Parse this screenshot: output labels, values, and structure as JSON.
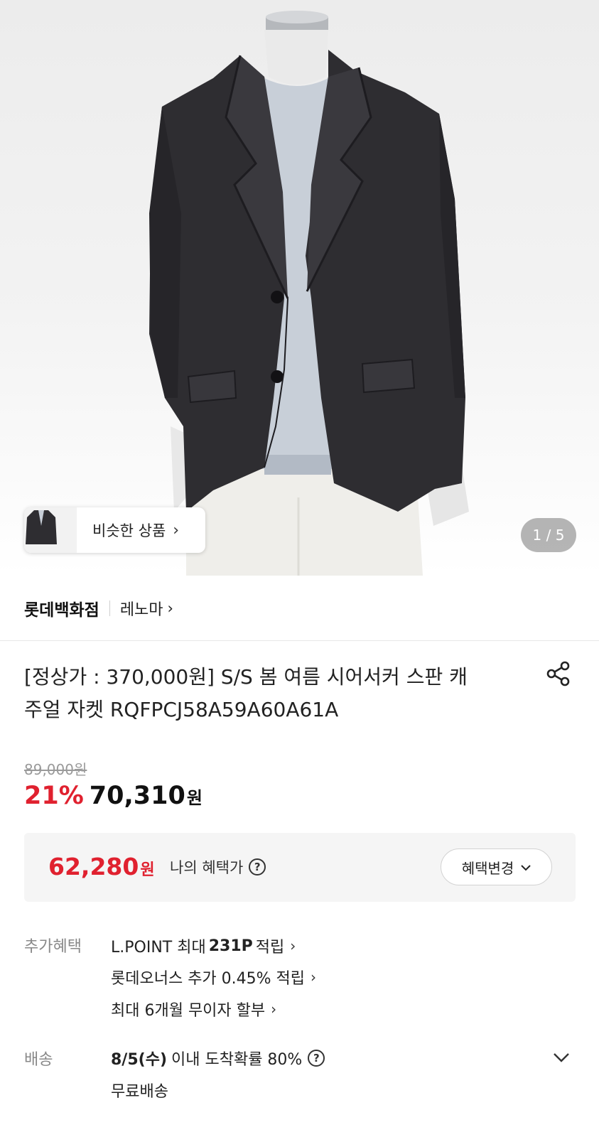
{
  "hero": {
    "page_indicator": "1 / 5",
    "similar_label": "비슷한 상품"
  },
  "store": {
    "name": "롯데백화점",
    "brand": "레노마"
  },
  "product": {
    "title_line1": "[정상가 : 370,000원] S/S 봄 여름 시어서커 스판 캐",
    "title_line2": "주얼 자켓 RQFPCJ58A59A60A61A"
  },
  "price": {
    "original": "89,000원",
    "discount": "21%",
    "sale": "70,310",
    "won": "원"
  },
  "benefit": {
    "price": "62,280",
    "won": "원",
    "label": "나의 혜택가",
    "change_button": "혜택변경"
  },
  "extra": {
    "label": "추가혜택",
    "lpoint_prefix": "L.POINT 최대",
    "lpoint_value": "231P",
    "lpoint_suffix": "적립",
    "lotte_plus": "롯데오너스 추가 0.45% 적립",
    "installment": "최대 6개월 무이자 할부"
  },
  "delivery": {
    "label": "배송",
    "date": "8/5(수)",
    "probability": "이내 도착확률 80%",
    "free": "무료배송"
  },
  "colors": {
    "accent_red": "#e0212f",
    "jacket": "#2e2d31"
  },
  "icons": [
    "chevron-right-icon",
    "share-icon",
    "question-icon",
    "chevron-down-icon"
  ]
}
